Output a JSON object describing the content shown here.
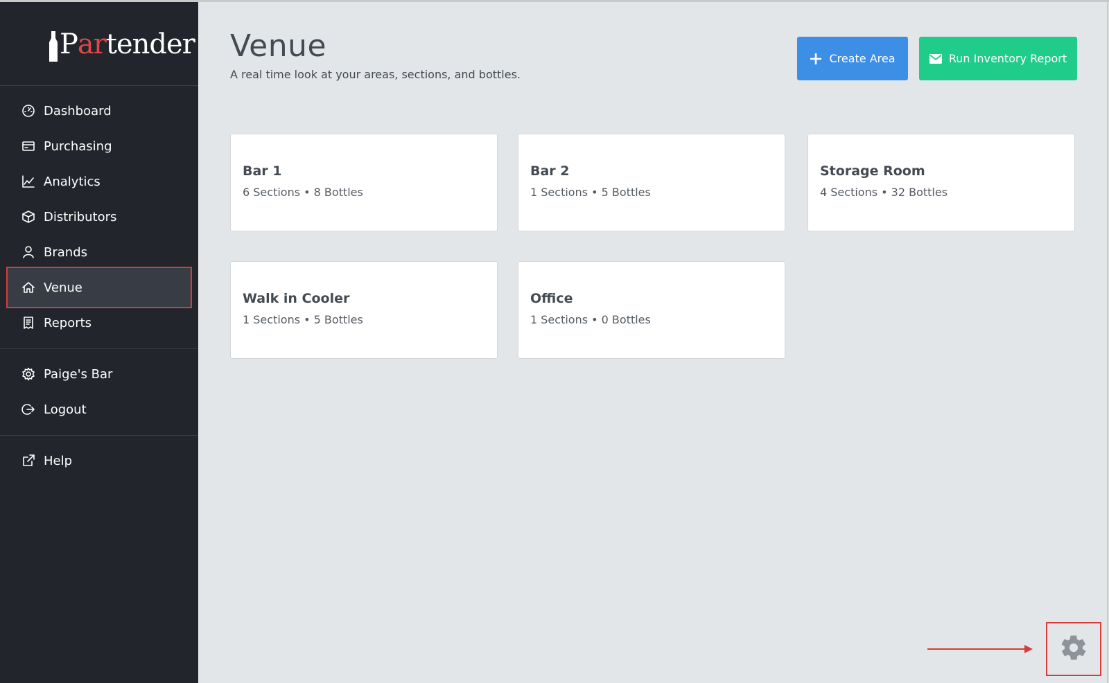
{
  "brand": {
    "logo_prefix": "P",
    "logo_red": "ar",
    "logo_suffix": "tender",
    "colors": {
      "sidebar": "#22252c",
      "accent_red": "#d93b3b",
      "logo_red": "#e04848"
    }
  },
  "sidebar": {
    "items": [
      {
        "label": "Dashboard",
        "icon": "speedometer-icon"
      },
      {
        "label": "Purchasing",
        "icon": "credit-card-icon"
      },
      {
        "label": "Analytics",
        "icon": "line-chart-icon"
      },
      {
        "label": "Distributors",
        "icon": "box-icon"
      },
      {
        "label": "Brands",
        "icon": "user-icon"
      },
      {
        "label": "Venue",
        "icon": "home-icon",
        "active": true
      },
      {
        "label": "Reports",
        "icon": "document-icon"
      }
    ],
    "account": [
      {
        "label": "Paige's Bar",
        "icon": "gear-icon"
      },
      {
        "label": "Logout",
        "icon": "logout-icon"
      }
    ],
    "help": {
      "label": "Help",
      "icon": "external-link-icon"
    }
  },
  "header": {
    "title": "Venue",
    "subtitle": "A real time look at your areas, sections, and bottles.",
    "create_label": "Create Area",
    "report_label": "Run Inventory Report",
    "create_color": "#3d8ee5",
    "report_color": "#1fcc8a"
  },
  "areas": [
    {
      "name": "Bar 1",
      "meta": "6 Sections • 8 Bottles"
    },
    {
      "name": "Bar 2",
      "meta": "1 Sections • 5 Bottles"
    },
    {
      "name": "Storage Room",
      "meta": "4 Sections • 32 Bottles"
    },
    {
      "name": "Walk in Cooler",
      "meta": "1 Sections • 5 Bottles"
    },
    {
      "name": "Office",
      "meta": "1 Sections • 0 Bottles"
    }
  ]
}
